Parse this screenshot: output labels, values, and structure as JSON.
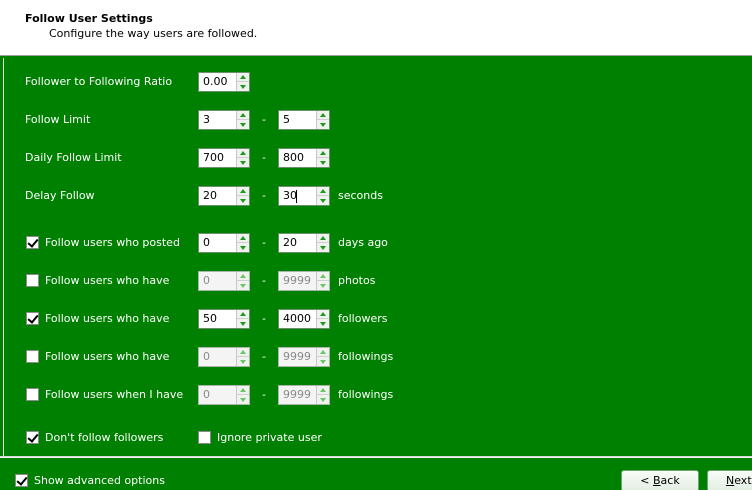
{
  "header": {
    "title": "Follow User Settings",
    "subtitle": "Configure the way users are followed."
  },
  "ratio": {
    "label": "Follower to Following Ratio",
    "value": "0.00"
  },
  "follow_limit": {
    "label": "Follow Limit",
    "min": "3",
    "max": "5"
  },
  "daily_limit": {
    "label": "Daily Follow Limit",
    "min": "700",
    "max": "800"
  },
  "delay": {
    "label": "Delay Follow",
    "min": "20",
    "max": "30",
    "unit": "seconds"
  },
  "posted": {
    "label": "Follow users who posted",
    "checked": true,
    "min": "0",
    "max": "20",
    "unit": "days ago"
  },
  "photos": {
    "label": "Follow users who have",
    "checked": false,
    "min": "0",
    "max": "9999",
    "unit": "photos"
  },
  "followers": {
    "label": "Follow users who have",
    "checked": true,
    "min": "50",
    "max": "4000",
    "unit": "followers"
  },
  "followings": {
    "label": "Follow users who have",
    "checked": false,
    "min": "0",
    "max": "9999",
    "unit": "followings"
  },
  "my_followings": {
    "label": "Follow users when I have",
    "checked": false,
    "min": "0",
    "max": "9999",
    "unit": "followings"
  },
  "dont_follow_followers": {
    "label": "Don't follow followers",
    "checked": true
  },
  "ignore_private": {
    "label": "Ignore private user",
    "checked": false
  },
  "range_separator": "-",
  "footer": {
    "advanced": {
      "label": "Show advanced options",
      "checked": true
    },
    "back": {
      "prefix": "< ",
      "mnemonic": "B",
      "rest": "ack"
    },
    "next": {
      "mnemonic": "N",
      "rest": "ext"
    }
  }
}
